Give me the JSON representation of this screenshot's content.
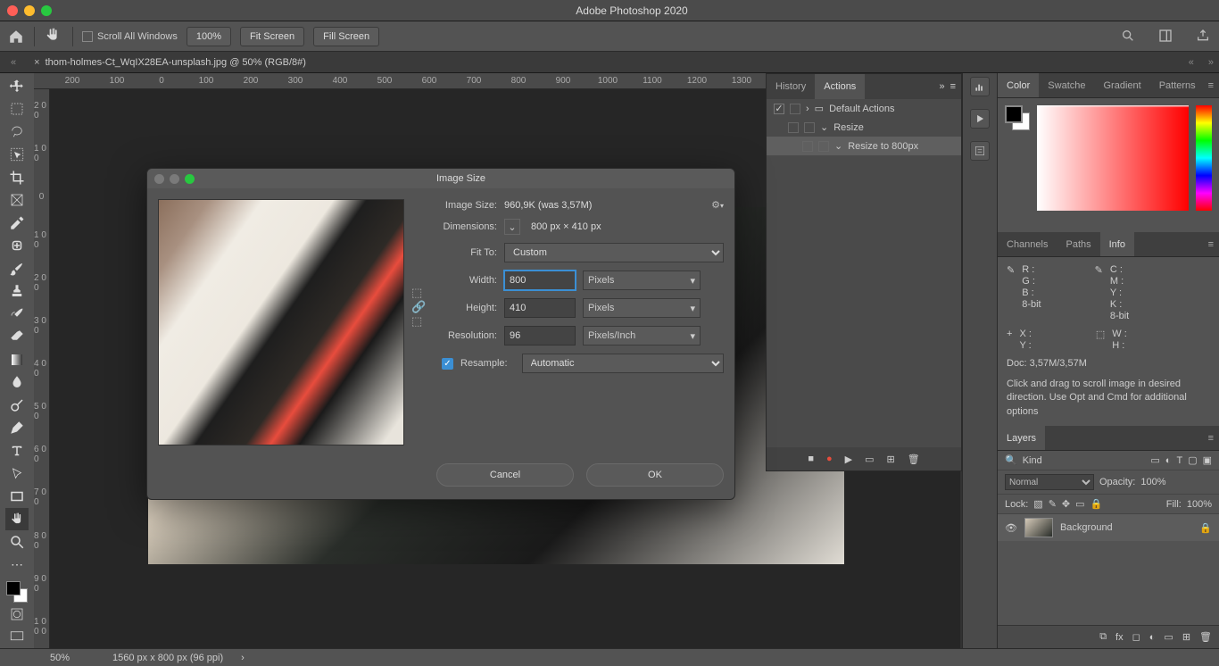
{
  "app": {
    "title": "Adobe Photoshop 2020"
  },
  "optbar": {
    "scroll_all": "Scroll All Windows",
    "zoom": "100%",
    "fit_screen": "Fit Screen",
    "fill_screen": "Fill Screen"
  },
  "tab": {
    "name": "thom-holmes-Ct_WqIX28EA-unsplash.jpg @ 50% (RGB/8#)"
  },
  "ruler_h": [
    "200",
    "100",
    "0",
    "100",
    "200",
    "300",
    "400",
    "500",
    "600",
    "700",
    "800",
    "900",
    "1000",
    "1100",
    "1200",
    "1300"
  ],
  "ruler_v": [
    "2 0 0",
    "1 0 0",
    "0",
    "1 0 0",
    "2 0 0",
    "3 0 0",
    "4 0 0",
    "5 0 0",
    "6 0 0",
    "7 0 0",
    "8 0 0",
    "9 0 0",
    "1 0 0 0"
  ],
  "actions": {
    "tabs": {
      "history": "History",
      "actions": "Actions"
    },
    "rows": [
      {
        "label": "Default Actions",
        "checked": true,
        "folder": true
      },
      {
        "label": "Resize",
        "checked": false,
        "indent": 1
      },
      {
        "label": "Resize to 800px",
        "checked": false,
        "indent": 2,
        "selected": true
      }
    ]
  },
  "color_tabs": {
    "color": "Color",
    "swatches": "Swatche",
    "gradients": "Gradient",
    "patterns": "Patterns"
  },
  "info_tabs": {
    "channels": "Channels",
    "paths": "Paths",
    "info": "Info"
  },
  "info": {
    "r": "R :",
    "g": "G :",
    "b": "B :",
    "bit1": "8-bit",
    "c": "C :",
    "m": "M :",
    "y": "Y :",
    "k": "K :",
    "bit2": "8-bit",
    "x": "X :",
    "yc": "Y :",
    "w": "W :",
    "h": "H :",
    "doc": "Doc: 3,57M/3,57M",
    "hint": "Click and drag to scroll image in desired direction.  Use Opt and Cmd for additional options"
  },
  "layers": {
    "tab": "Layers",
    "kind": "Kind",
    "blend": "Normal",
    "opacity_lbl": "Opacity:",
    "opacity_val": "100%",
    "lock_lbl": "Lock:",
    "fill_lbl": "Fill:",
    "fill_val": "100%",
    "bg_layer": "Background"
  },
  "status": {
    "zoom": "50%",
    "dims": "1560 px x 800 px (96 ppi)"
  },
  "dialog": {
    "title": "Image Size",
    "image_size_lbl": "Image Size:",
    "image_size_val": "960,9K (was 3,57M)",
    "dimensions_lbl": "Dimensions:",
    "dimensions_val": "800 px  ×  410 px",
    "fit_to_lbl": "Fit To:",
    "fit_to_val": "Custom",
    "width_lbl": "Width:",
    "width_val": "800",
    "width_unit": "Pixels",
    "height_lbl": "Height:",
    "height_val": "410",
    "height_unit": "Pixels",
    "resolution_lbl": "Resolution:",
    "resolution_val": "96",
    "resolution_unit": "Pixels/Inch",
    "resample_lbl": "Resample:",
    "resample_val": "Automatic",
    "cancel": "Cancel",
    "ok": "OK"
  }
}
